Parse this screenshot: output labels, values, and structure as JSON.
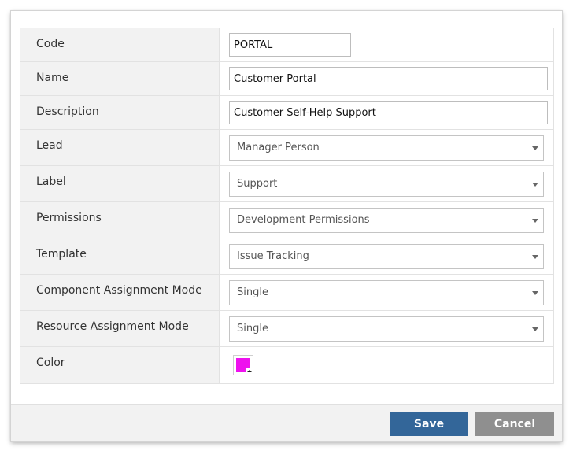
{
  "form": {
    "code": {
      "label": "Code",
      "value": "PORTAL"
    },
    "name": {
      "label": "Name",
      "value": "Customer Portal"
    },
    "description": {
      "label": "Description",
      "value": "Customer Self-Help Support"
    },
    "lead": {
      "label": "Lead",
      "value": "Manager Person"
    },
    "project_label": {
      "label": "Label",
      "value": "Support"
    },
    "permissions": {
      "label": "Permissions",
      "value": "Development Permissions"
    },
    "template": {
      "label": "Template",
      "value": "Issue Tracking"
    },
    "component_assignment_mode": {
      "label": "Component Assignment Mode",
      "value": "Single"
    },
    "resource_assignment_mode": {
      "label": "Resource Assignment Mode",
      "value": "Single"
    },
    "color": {
      "label": "Color",
      "value": "#ee11ee"
    }
  },
  "footer": {
    "save_label": "Save",
    "cancel_label": "Cancel"
  },
  "icons": {
    "dropdown": "chevron-down-icon",
    "color_picker": "color-picker-icon"
  }
}
